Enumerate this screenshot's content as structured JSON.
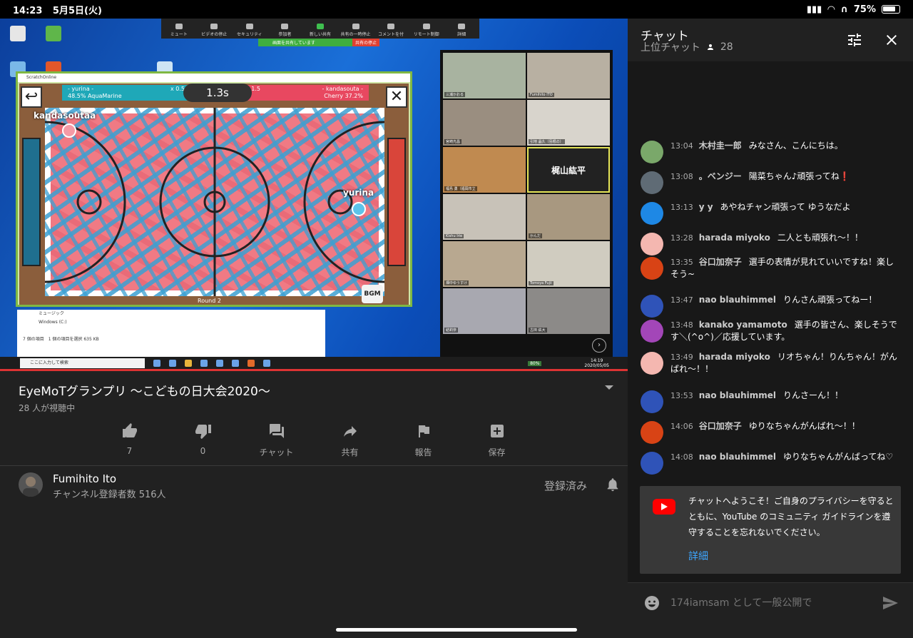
{
  "status_bar": {
    "time": "14:23",
    "date": "5月5日(火)",
    "battery": "75%"
  },
  "zoom": {
    "toolbar": [
      {
        "label": "ミュート"
      },
      {
        "label": "ビデオの停止"
      },
      {
        "label": "セキュリティ"
      },
      {
        "label": "参加者"
      },
      {
        "label": "新しい共有"
      },
      {
        "label": "共有の一時停止"
      },
      {
        "label": "コメントを付"
      },
      {
        "label": "リモート制御"
      },
      {
        "label": "詳細"
      }
    ],
    "share_banner": "画面を共有しています",
    "share_stop": "共有の停止",
    "gallery": [
      {
        "name": "三浦かおる"
      },
      {
        "name": "Fumihito ITO"
      },
      {
        "name": "宮崎光昌"
      },
      {
        "name": "引地 晶久（島根の）"
      },
      {
        "name": "福島 勇（福岡市立"
      },
      {
        "name": "梶山紘平"
      },
      {
        "name": "Kishu Irie"
      },
      {
        "name": "かんだ"
      },
      {
        "name": "畑中ゆうすけ"
      },
      {
        "name": "Tomoya Fujii"
      },
      {
        "name": "結莉奈"
      },
      {
        "name": "古田 紘大"
      }
    ],
    "taskbar_search": "ここに入力して検索",
    "clock": "14:19",
    "clock_date": "2020/05/05",
    "zoom_percent": "80%"
  },
  "scratch": {
    "window_title": "ScratchOnline",
    "left_player": "- yurina -",
    "left_team": "48.5% AquaMarine",
    "left_mult": "x 0.5",
    "right_player": "- kandasouta -",
    "right_team": "Cherry 37.2%",
    "right_mult": "x 1.5",
    "timer": "1.3s",
    "player_top": "kandasoutaa",
    "player_right": "yurina",
    "round": "Round 2",
    "bgm": "BGM"
  },
  "explorer": {
    "items": [
      "ミュージック",
      "Windows (C:)"
    ],
    "status": "7 個の項目　1 個の項目を選択  635 KB"
  },
  "video": {
    "title": "EyeMoTグランプリ 〜こどもの日大会2020〜",
    "viewers": "28 人が視聴中",
    "actions": [
      {
        "label": "7",
        "icon": "thumbs-up-icon"
      },
      {
        "label": "0",
        "icon": "thumbs-down-icon"
      },
      {
        "label": "チャット",
        "icon": "chat-icon"
      },
      {
        "label": "共有",
        "icon": "share-icon"
      },
      {
        "label": "報告",
        "icon": "flag-icon"
      },
      {
        "label": "保存",
        "icon": "add-playlist-icon"
      }
    ],
    "channel": "Fumihito Ito",
    "subscribers": "チャンネル登録者数 516人",
    "subscribed": "登録済み"
  },
  "chat": {
    "title": "チャット",
    "subtitle": "上位チャット",
    "viewer_count": "28",
    "messages": [
      {
        "time": "13:04",
        "author": "木村圭一郎",
        "text": "みなさん、こんにちは。",
        "color": "#7aa86a"
      },
      {
        "time": "13:08",
        "author": "。ベンジー",
        "text": "陽菜ちゃん♪頑張ってね❗",
        "color": "#5f6b75"
      },
      {
        "time": "13:13",
        "author": "y y",
        "text": "あやねチャン頑張って ゆうなだよ",
        "color": "#1e88e5"
      },
      {
        "time": "13:28",
        "author": "harada miyoko",
        "text": "二人とも頑張れ〜！！",
        "color": "#f4b7b0"
      },
      {
        "time": "13:35",
        "author": "谷口加奈子",
        "text": "選手の表情が見れていいですね！楽しそう~",
        "color": "#d84315"
      },
      {
        "time": "13:47",
        "author": "nao blauhimmel",
        "text": "りんさん頑張ってねー！",
        "color": "#2f53b8"
      },
      {
        "time": "13:48",
        "author": "kanako yamamoto",
        "text": "選手の皆さん、楽しそうです＼(^o^)／応援しています。",
        "color": "#a346b8"
      },
      {
        "time": "13:49",
        "author": "harada miyoko",
        "text": "リオちゃん！りんちゃん！がんばれ〜！！",
        "color": "#f4b7b0"
      },
      {
        "time": "13:53",
        "author": "nao blauhimmel",
        "text": "りんさーん！！",
        "color": "#2f53b8"
      },
      {
        "time": "14:06",
        "author": "谷口加奈子",
        "text": "ゆりなちゃんがんばれ〜！！",
        "color": "#d84315"
      },
      {
        "time": "14:08",
        "author": "nao blauhimmel",
        "text": "ゆりなちゃんがんばってね♡",
        "color": "#2f53b8"
      }
    ],
    "welcome": "チャットへようこそ！ご自身のプライバシーを守るとともに、YouTube のコミュニティ ガイドラインを遵守することを忘れないでください。",
    "welcome_more": "詳細",
    "input_placeholder": "174iamsam として一般公開で"
  }
}
